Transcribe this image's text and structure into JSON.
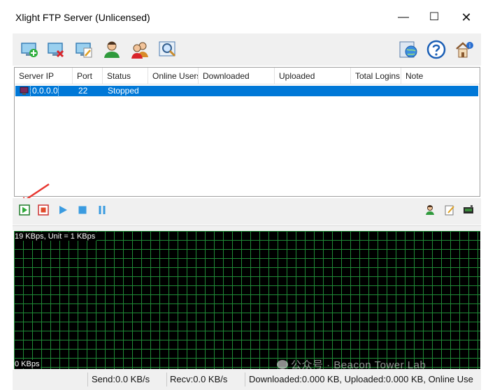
{
  "window": {
    "title": "Xlight FTP Server (Unlicensed)",
    "minimize": "—",
    "maximize": "☐",
    "close": "✕"
  },
  "toolbar": {
    "buttons": [
      {
        "name": "add-server-icon"
      },
      {
        "name": "delete-server-icon"
      },
      {
        "name": "edit-server-icon"
      },
      {
        "name": "user-icon"
      },
      {
        "name": "users-group-icon"
      },
      {
        "name": "search-icon"
      },
      {
        "name": "global-settings-icon"
      },
      {
        "name": "help-icon"
      },
      {
        "name": "about-icon"
      }
    ]
  },
  "table": {
    "columns": [
      "Server IP",
      "Port",
      "Status",
      "Online Users",
      "Downloaded",
      "Uploaded",
      "Total Logins",
      "Note"
    ],
    "rows": [
      {
        "server_ip": "0.0.0.0",
        "port": "22",
        "status": "Stopped",
        "online_users": "",
        "downloaded": "",
        "uploaded": "",
        "total_logins": "",
        "note": ""
      }
    ]
  },
  "controls": {
    "left": [
      "start-server-icon",
      "stop-server-icon",
      "play-icon",
      "stop-icon",
      "pause-icon"
    ],
    "right": [
      "user-settings-icon",
      "edit-notes-icon",
      "log-icon"
    ]
  },
  "graph": {
    "top_label": "19 KBps, Unit = 1 KBps",
    "bottom_label": "0 KBps",
    "grid_color": "#1f8a36"
  },
  "statusbar": {
    "send": "Send:0.0 KB/s",
    "recv": "Recv:0.0 KB/s",
    "totals": "Downloaded:0.000 KB, Uploaded:0.000 KB, Online Use"
  },
  "watermark": "公众号 · Beacon Tower Lab",
  "colors": {
    "selection": "#0078d7",
    "annotation_arrow": "#e8352f"
  }
}
